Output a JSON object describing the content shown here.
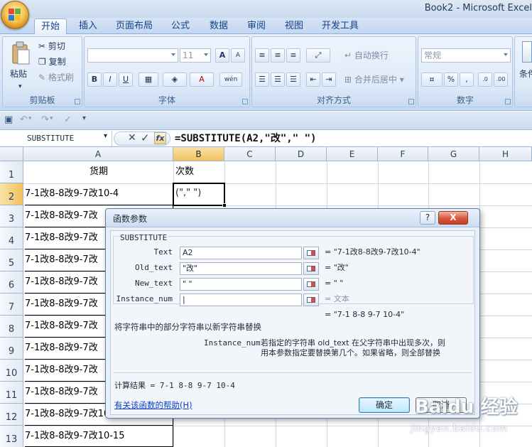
{
  "window": {
    "title": "Book2 - Microsoft Excel"
  },
  "tabs": [
    "开始",
    "插入",
    "页面布局",
    "公式",
    "数据",
    "审阅",
    "视图",
    "开发工具"
  ],
  "ribbon": {
    "clipboard": {
      "label": "剪贴板",
      "paste": "粘贴",
      "cut": "剪切",
      "copy": "复制",
      "format_painter": "格式刷"
    },
    "font": {
      "label": "字体",
      "size": "11",
      "bold": "B",
      "italic": "I",
      "underline": "U",
      "grow": "A",
      "shrink": "A",
      "wen": "wén"
    },
    "alignment": {
      "label": "对齐方式",
      "wrap": "自动换行",
      "merge": "合并后居中"
    },
    "number": {
      "label": "数字",
      "format": "常规",
      "percent": "%",
      "comma": ",",
      "inc": ".0",
      "dec": ".00"
    },
    "styles": {
      "partial_label": "条件"
    }
  },
  "formula_bar": {
    "name_box": "SUBSTITUTE",
    "fx": "fx",
    "formula": "=SUBSTITUTE(A2,\"改\",\" \")"
  },
  "columns": [
    "A",
    "B",
    "C",
    "D",
    "E",
    "F",
    "G",
    "H"
  ],
  "rows": [
    "1",
    "2",
    "3",
    "4",
    "5",
    "6",
    "7",
    "8",
    "9",
    "10",
    "11",
    "12",
    "13"
  ],
  "cells": {
    "A1": "货期",
    "B1": "次数",
    "B2": "(\",\" \")",
    "A_values": [
      "7-1改8-8改9-7改10-4",
      "7-1改8-8改9-7改",
      "7-1改8-8改9-7改",
      "7-1改8-8改9-7改",
      "7-1改8-8改9-7改",
      "7-1改8-8改9-7改",
      "7-1改8-8改9-7改",
      "7-1改8-8改9-7改",
      "7-1改8-8改9-7改",
      "7-1改8-8改9-7改",
      "7-1改8-8改9-7改10-1",
      "7-1改8-8改9-7改10-15"
    ]
  },
  "dialog": {
    "title": "函数参数",
    "help_btn": "?",
    "close_btn": "X",
    "function_name": "SUBSTITUTE",
    "args": [
      {
        "label": "Text",
        "value": "A2",
        "result": "= \"7-1改8-8改9-7改10-4\""
      },
      {
        "label": "Old_text",
        "value": "\"改\"",
        "result": "= \"改\""
      },
      {
        "label": "New_text",
        "value": "\" \"",
        "result": "= \" \""
      },
      {
        "label": "Instance_num",
        "value": "|",
        "result": "= 文本"
      }
    ],
    "overall_result": "= \"7-1 8-8 9-7 10-4\"",
    "description": "将字符串中的部分字符串以新字符串替换",
    "param_name": "Instance_num",
    "param_desc_1": "若指定的字符串 old_text 在父字符串中出现多次，则",
    "param_desc_2": "用本参数指定要替换第几个。如果省略，则全部替换",
    "calc_result": "计算结果 =  7-1 8-8 9-7 10-4",
    "help_link": "有关该函数的帮助(H)",
    "ok": "确定",
    "cancel": "取消"
  },
  "watermark": {
    "text": "Baidu 经验",
    "url": "jingyan.baidu.com"
  }
}
